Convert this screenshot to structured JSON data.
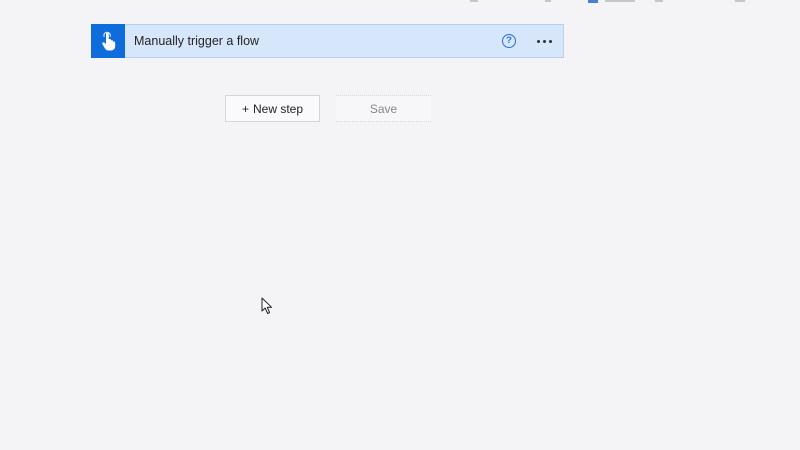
{
  "trigger": {
    "title": "Manually trigger a flow",
    "icon": "hand-pointer-icon",
    "help_icon": "question-circle-icon",
    "more_icon": "ellipsis-icon",
    "icon_bg_color": "#0f6cdb",
    "card_bg_color": "#d6e6fb"
  },
  "actions": {
    "new_step_prefix": "+",
    "new_step_label": "New step",
    "save_label": "Save"
  }
}
